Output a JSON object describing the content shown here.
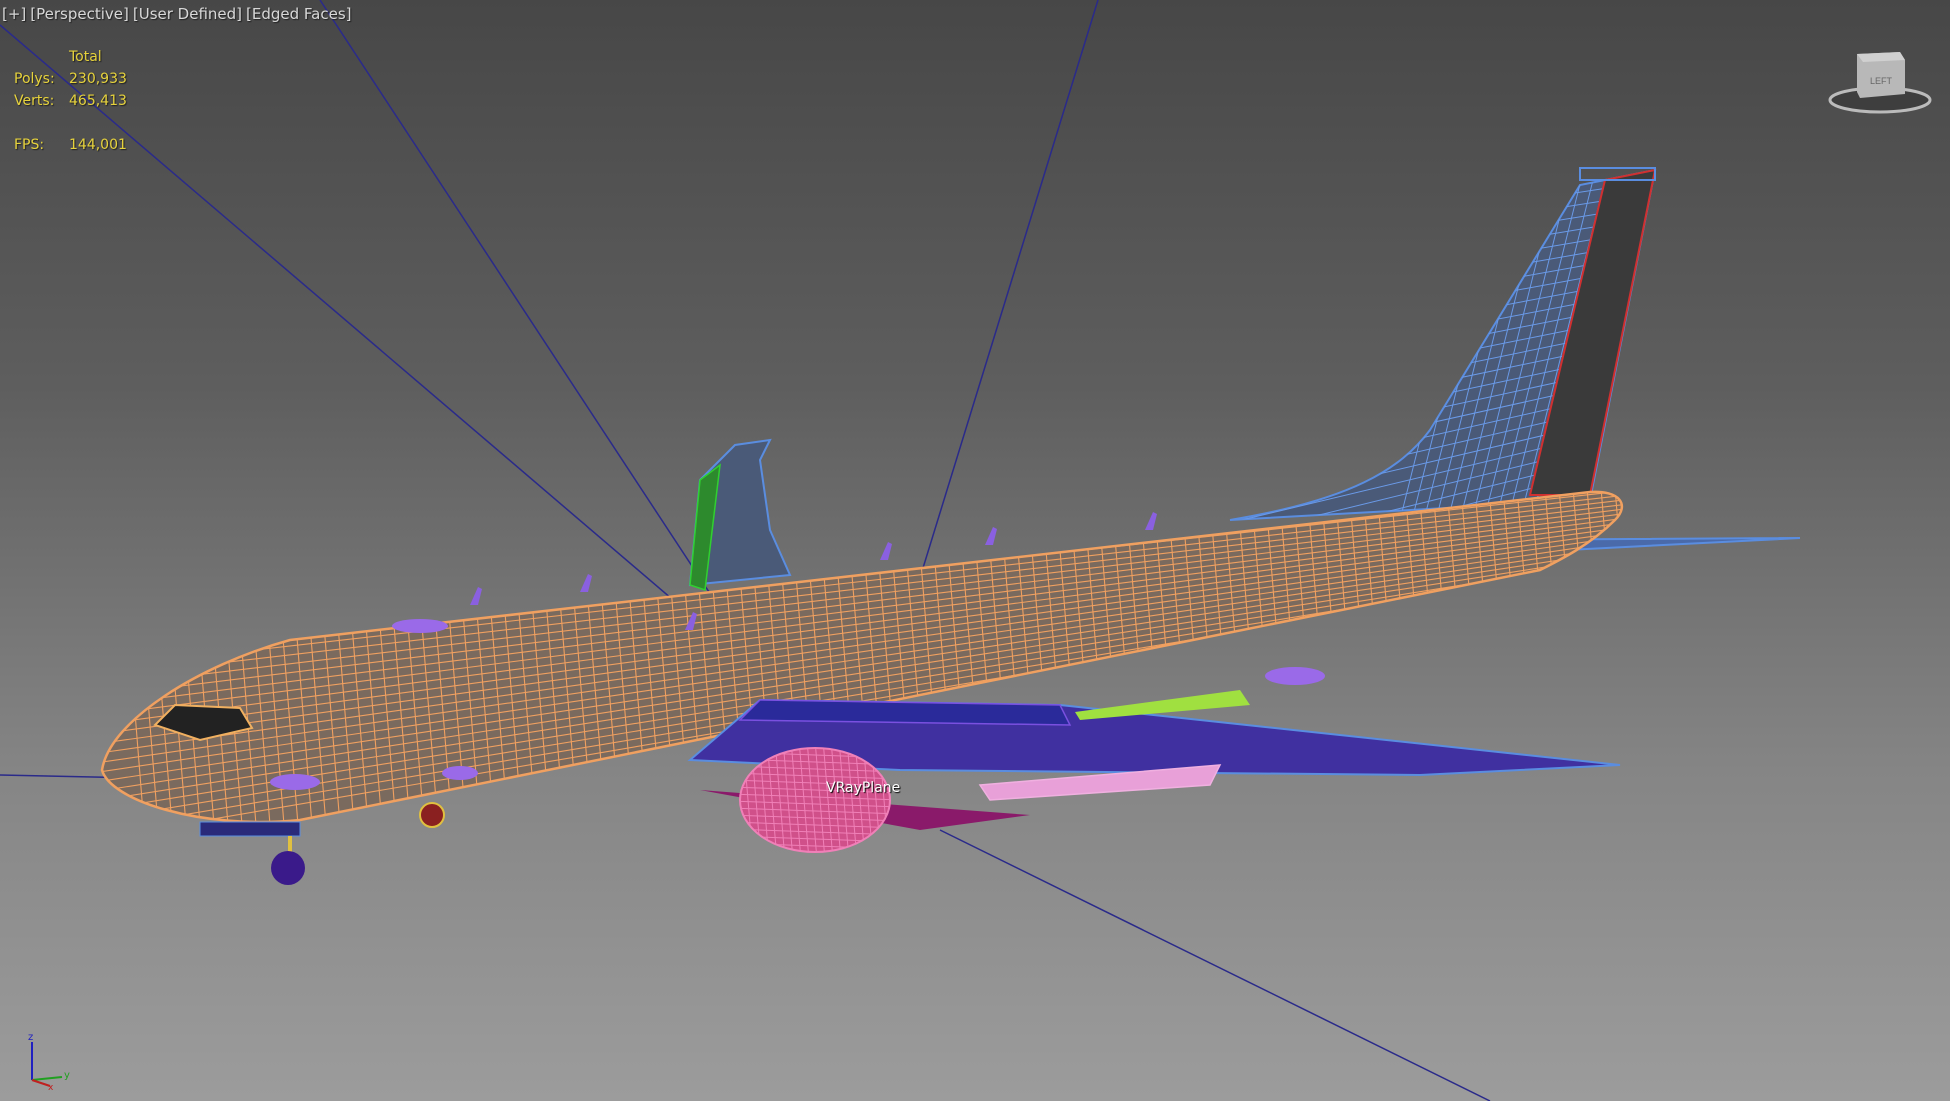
{
  "viewport": {
    "labels": [
      "[+]",
      "[Perspective]",
      "[User Defined]",
      "[Edged Faces]"
    ]
  },
  "stats": {
    "header": "Total",
    "polys_label": "Polys:",
    "polys_value": "230,933",
    "verts_label": "Verts:",
    "verts_value": "465,413",
    "fps_label": "FPS:",
    "fps_value": "144,001"
  },
  "scene": {
    "object_label": "VRayPlane",
    "fuselage_color": "#f0a060",
    "tail_color": "#5a8de0",
    "engine_color": "#e060a0",
    "line_color": "#2a2a8a"
  },
  "viewcube": {
    "face_label": "LEFT"
  },
  "axis_gizmo": {
    "x": "x",
    "y": "y",
    "z": "z"
  }
}
